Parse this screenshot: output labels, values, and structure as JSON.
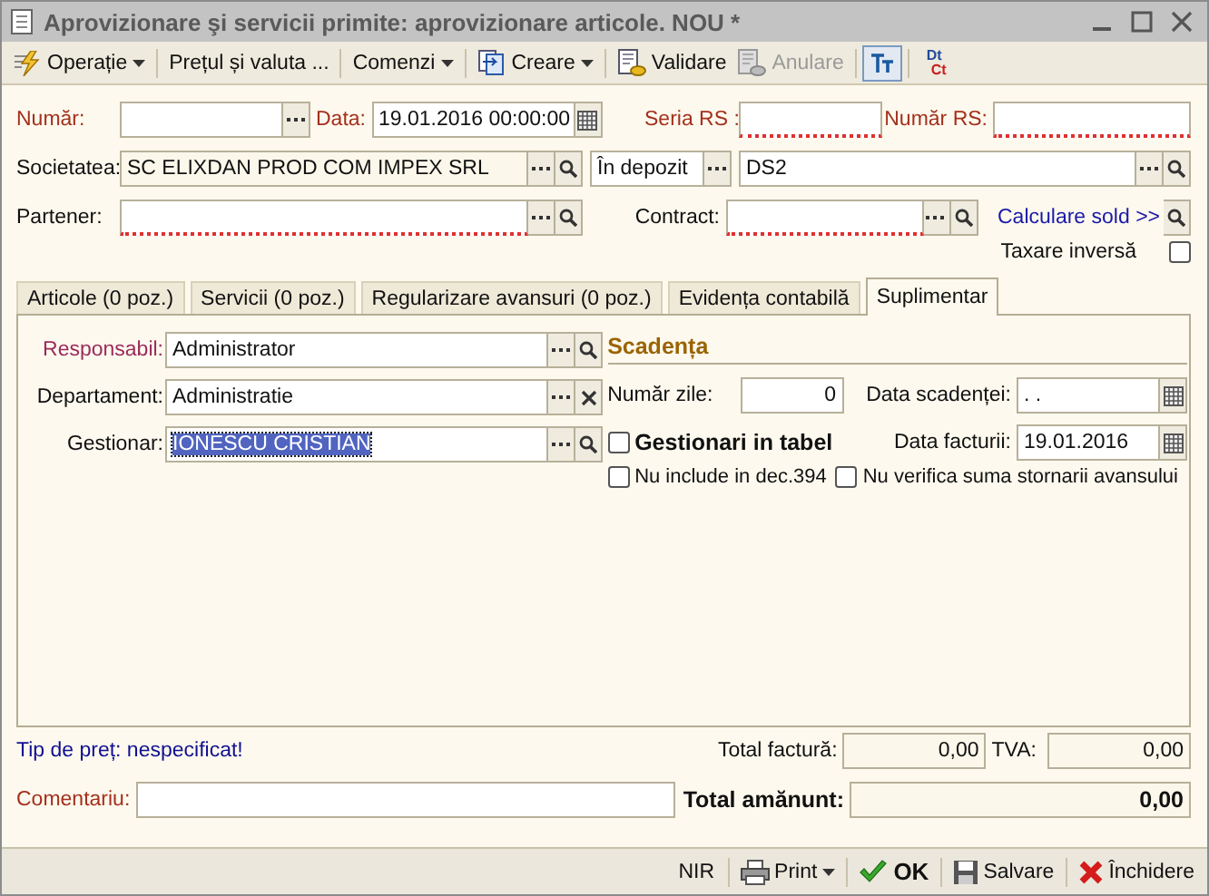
{
  "window": {
    "title": "Aprovizionare şi servicii primite: aprovizionare articole. NOU *"
  },
  "toolbar": [
    {
      "kind": "menu",
      "label": "Operație",
      "dropdown": true
    },
    {
      "kind": "menu",
      "label": "Prețul și valuta ...",
      "dropdown": false
    },
    {
      "kind": "menu",
      "label": "Comenzi",
      "dropdown": true
    },
    {
      "kind": "menu",
      "label": "Creare",
      "dropdown": true
    },
    {
      "kind": "button",
      "label": "Validare",
      "disabled": false
    },
    {
      "kind": "button",
      "label": "Anulare",
      "disabled": true
    },
    {
      "kind": "toggle",
      "pressed": true
    },
    {
      "kind": "dtct",
      "top": "Dt",
      "bottom": "Ct"
    }
  ],
  "header": {
    "numar": {
      "label": "Număr:",
      "required": true,
      "invalid": false
    },
    "data": {
      "label": "Data:",
      "required": true,
      "value": "19.01.2016 00:00:00",
      "invalid": false
    },
    "seria_rs": {
      "label": "Seria RS :",
      "required": true,
      "invalid": true
    },
    "numar_rs": {
      "label": "Număr RS:",
      "required": true,
      "invalid": true
    },
    "societatea": {
      "label": "Societatea:",
      "required": false,
      "value": "SC ELIXDAN PROD COM IMPEX SRL",
      "invalid": false
    },
    "depozit": {
      "value": "În depozit",
      "invalid": false
    },
    "gestiune": {
      "value": "DS2",
      "invalid": false
    },
    "partener": {
      "label": "Partener:",
      "required": false,
      "invalid": true
    },
    "contract": {
      "label": "Contract:",
      "required": false,
      "invalid": true
    },
    "calculare_sold": {
      "label": "Calculare sold >>"
    },
    "taxare_inversa": {
      "label": "Taxare inversă",
      "checked": false
    }
  },
  "tabs": [
    {
      "label": "Articole (0 poz.)",
      "selected": false
    },
    {
      "label": "Servicii (0 poz.)",
      "selected": false
    },
    {
      "label": "Regularizare avansuri (0 poz.)",
      "selected": false
    },
    {
      "label": "Evidența contabilă",
      "selected": false
    },
    {
      "label": "Suplimentar",
      "selected": true
    }
  ],
  "panel": {
    "responsabil": {
      "label": "Responsabil:",
      "required": true,
      "value": "Administrator"
    },
    "departament": {
      "label": "Departament:",
      "required": false,
      "value": "Administratie"
    },
    "gestionar": {
      "label": "Gestionar:",
      "required": false,
      "value": "IONESCU CRISTIAN",
      "highlighted": true
    },
    "scadenta": {
      "title": "Scadența",
      "numar_zile": {
        "label": "Număr zile:",
        "value": "0"
      },
      "data_scadentei": {
        "label": "Data scadenței:",
        "value": ". ."
      },
      "gestionari_in_tabel": {
        "label": "Gestionari in tabel",
        "checked": false
      },
      "data_facturii": {
        "label": "Data facturii:",
        "value": "19.01.2016"
      },
      "options": [
        {
          "label": "Nu include in dec.394",
          "checked": false
        },
        {
          "label": "Nu verifica suma stornarii avansului",
          "checked": false
        }
      ]
    }
  },
  "footer": {
    "tip_pret": {
      "text": "Tip de preț: nespecificat!"
    },
    "total_factura": {
      "label": "Total factură:",
      "value": "0,00"
    },
    "tva": {
      "label": "TVA:",
      "value": "0,00"
    },
    "comentariu": {
      "label": "Comentariu:",
      "required": true
    },
    "total_amanunt": {
      "label": "Total amănunt:",
      "value": "0,00"
    }
  },
  "status_bar": [
    {
      "kind": "text",
      "label": "NIR"
    },
    {
      "kind": "print",
      "label": "Print"
    },
    {
      "kind": "ok",
      "label": "OK"
    },
    {
      "kind": "save",
      "label": "Salvare"
    },
    {
      "kind": "close",
      "label": "Închidere"
    }
  ]
}
